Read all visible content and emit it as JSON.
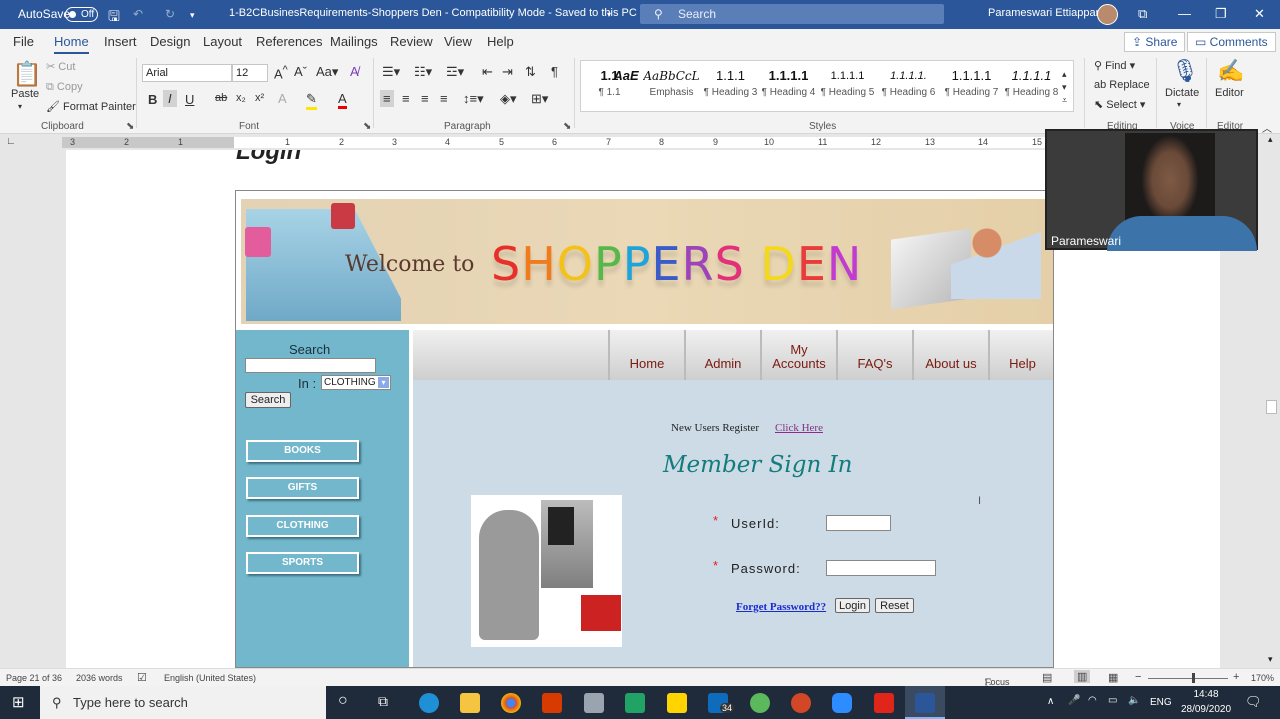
{
  "titlebar": {
    "autosave": "AutoSave",
    "toggle": "Off",
    "doc_title": "1-B2CBusinesRequirements-Shoppers Den  -  Compatibility Mode  -  Saved to this PC",
    "search": "Search",
    "user": "Parameswari Ettiappan"
  },
  "menu": {
    "items": [
      "File",
      "Home",
      "Insert",
      "Design",
      "Layout",
      "References",
      "Mailings",
      "Review",
      "View",
      "Help"
    ],
    "share": "Share",
    "comments": "Comments"
  },
  "ribbon": {
    "clipboard": {
      "paste": "Paste",
      "cut": "Cut",
      "copy": "Copy",
      "format_painter": "Format Painter",
      "group": "Clipboard"
    },
    "font": {
      "name": "Arial",
      "size": "12",
      "group": "Font"
    },
    "paragraph": {
      "group": "Paragraph"
    },
    "styles": {
      "group": "Styles",
      "items": [
        {
          "sample": "1.1",
          "name": "¶ 1.1"
        },
        {
          "sample": "AaE",
          "name": ""
        },
        {
          "sample": "AaBbCcL",
          "name": "Emphasis"
        },
        {
          "sample": "1.1.1",
          "name": "¶ Heading 3"
        },
        {
          "sample": "1.1.1.1",
          "name": "¶ Heading 4"
        },
        {
          "sample": "1.1.1.1",
          "name": "¶ Heading 5"
        },
        {
          "sample": "1.1.1.1.",
          "name": "¶ Heading 6"
        },
        {
          "sample": "1.1.1.1",
          "name": "¶ Heading 7"
        },
        {
          "sample": "1.1.1.1",
          "name": "¶ Heading 8"
        }
      ]
    },
    "editing": {
      "find": "Find",
      "replace": "Replace",
      "select": "Select",
      "group": "Editing"
    },
    "voice": {
      "dictate": "Dictate",
      "group": "Voice"
    },
    "editor": {
      "label": "Editor",
      "group": "Editor"
    }
  },
  "ruler": {
    "numbers": [
      "3",
      "2",
      "1",
      "1",
      "2",
      "3",
      "4",
      "5",
      "6",
      "7",
      "8",
      "9",
      "10",
      "11",
      "12",
      "13",
      "14",
      "15"
    ]
  },
  "doc": {
    "heading": "Login"
  },
  "site": {
    "welcome": "Welcome to",
    "brand_letters": [
      "S",
      "H",
      "O",
      "P",
      "P",
      "E",
      "R",
      "S",
      " ",
      "D",
      "E",
      "N"
    ],
    "brand_colors": [
      "#e8302b",
      "#f07b1c",
      "#f2c21b",
      "#55b848",
      "#1fa4d9",
      "#3b5bc9",
      "#9d45b8",
      "#e2307a",
      "#ffffff",
      "#f4d81c",
      "#e93b3b",
      "#c23bd1"
    ],
    "search_label": "Search",
    "in_label": "In :",
    "category_value": "CLOTHING",
    "search_button": "Search",
    "categories": [
      "BOOKS",
      "GIFTS",
      "CLOTHING",
      "SPORTS"
    ],
    "nav": [
      {
        "l1": "Home"
      },
      {
        "l1": "Admin"
      },
      {
        "l1": "My",
        "l2": "Accounts"
      },
      {
        "l1": "FAQ's"
      },
      {
        "l1": "About us"
      },
      {
        "l1": "Help"
      }
    ],
    "register_text": "New Users Register",
    "click_here": "Click Here",
    "signin_title": "Member Sign In",
    "userid_label": "UserId:",
    "password_label": "Password:",
    "required": "*",
    "forget": "Forget Password??",
    "login_button": "Login",
    "reset_button": "Reset"
  },
  "webcam": {
    "name": "Parameswari"
  },
  "status": {
    "page": "Page 21 of 36",
    "words": "2036 words",
    "language": "English (United States)",
    "focus": "Focus",
    "zoom": "170%"
  },
  "taskbar": {
    "search": "Type here to search",
    "mail_badge": "34",
    "lang": "ENG",
    "time": "14:48",
    "date": "28/09/2020"
  }
}
